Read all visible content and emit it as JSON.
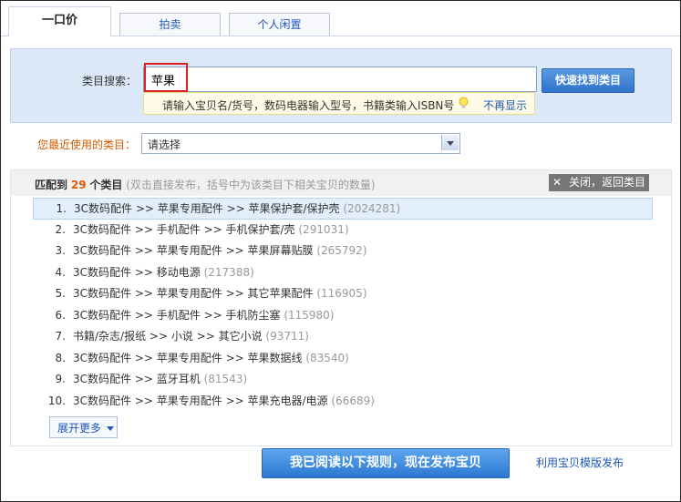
{
  "tabs": [
    {
      "label": "一口价"
    },
    {
      "label": "拍卖"
    },
    {
      "label": "个人闲置"
    }
  ],
  "search": {
    "label": "类目搜索：",
    "value": "苹果",
    "quick_button": "快速找到类目",
    "hint": "请输入宝贝名/货号，数码电器输入型号，书籍类输入ISBN号",
    "no_show": "不再显示"
  },
  "recent": {
    "label": "您最近使用的类目：",
    "selected": "请选择"
  },
  "results": {
    "prefix": "匹配到",
    "count": "29",
    "suffix": "个类目",
    "note": "(双击直接发布，括号中为该类目下相关宝贝的数量)",
    "close_label": "关闭，返回类目",
    "close_symbol": "✕",
    "items": [
      {
        "num": "1.",
        "path": "3C数码配件 >> 苹果专用配件 >> 苹果保护套/保护壳",
        "count": "(2024281)"
      },
      {
        "num": "2.",
        "path": "3C数码配件 >> 手机配件 >> 手机保护套/壳",
        "count": "(291031)"
      },
      {
        "num": "3.",
        "path": "3C数码配件 >> 苹果专用配件 >> 苹果屏幕贴膜",
        "count": "(265792)"
      },
      {
        "num": "4.",
        "path": "3C数码配件 >> 移动电源",
        "count": "(217388)"
      },
      {
        "num": "5.",
        "path": "3C数码配件 >> 苹果专用配件 >> 其它苹果配件",
        "count": "(116905)"
      },
      {
        "num": "6.",
        "path": "3C数码配件 >> 手机配件 >> 手机防尘塞",
        "count": "(115980)"
      },
      {
        "num": "7.",
        "path": "书籍/杂志/报纸 >> 小说 >> 其它小说",
        "count": "(93711)"
      },
      {
        "num": "8.",
        "path": "3C数码配件 >> 苹果专用配件 >> 苹果数据线",
        "count": "(83540)"
      },
      {
        "num": "9.",
        "path": "3C数码配件 >> 蓝牙耳机",
        "count": "(81543)"
      },
      {
        "num": "10.",
        "path": "3C数码配件 >> 苹果专用配件 >> 苹果充电器/电源",
        "count": "(66689)"
      }
    ],
    "more_label": "展开更多"
  },
  "footer": {
    "publish_button": "我已阅读以下规则，现在发布宝贝",
    "template_link": "利用宝贝模版发布"
  },
  "colors": {
    "accent": "#2f74cc",
    "link": "#1e57b6",
    "highlight": "#e02020",
    "recent_label": "#d05a00"
  }
}
